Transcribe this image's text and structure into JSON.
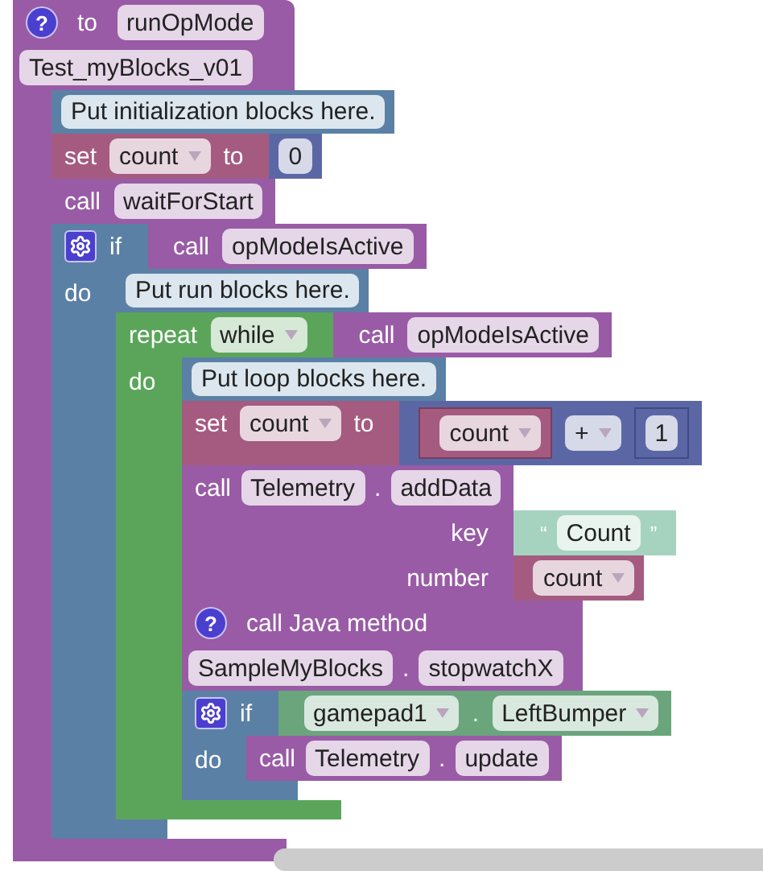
{
  "procedure": {
    "help": "?",
    "keyword": "to",
    "name": "runOpMode",
    "subtitle": "Test_myBlocks_v01",
    "statements": [
      {
        "kind": "comment",
        "text": "Put initialization blocks here."
      },
      {
        "kind": "set",
        "keyword": "set",
        "variable": "count",
        "to": "to",
        "value": {
          "kind": "number",
          "value": "0"
        }
      },
      {
        "kind": "call",
        "keyword": "call",
        "name": "waitForStart"
      },
      {
        "kind": "if",
        "keyword": "if",
        "do_label": "do",
        "condition": {
          "kind": "call",
          "keyword": "call",
          "name": "opModeIsActive"
        },
        "body": [
          {
            "kind": "comment",
            "text": "Put run blocks here."
          },
          {
            "kind": "repeat",
            "keyword": "repeat",
            "mode": "while",
            "do_label": "do",
            "condition": {
              "kind": "call",
              "keyword": "call",
              "name": "opModeIsActive"
            },
            "body": [
              {
                "kind": "comment",
                "text": "Put loop blocks here."
              },
              {
                "kind": "set",
                "keyword": "set",
                "variable": "count",
                "to": "to",
                "value": {
                  "kind": "arith",
                  "left": {
                    "kind": "variable",
                    "name": "count"
                  },
                  "op": "+",
                  "right": {
                    "kind": "number",
                    "value": "1"
                  }
                }
              },
              {
                "kind": "method_call",
                "keyword": "call",
                "object": "Telemetry",
                "separator": ".",
                "method": "addData",
                "args": [
                  {
                    "label": "key",
                    "value": {
                      "kind": "text",
                      "open": "“",
                      "value": "Count",
                      "close": "”"
                    }
                  },
                  {
                    "label": "number",
                    "value": {
                      "kind": "variable",
                      "name": "count"
                    }
                  }
                ]
              },
              {
                "kind": "java_call",
                "help": "?",
                "title": "call Java method",
                "class": "SampleMyBlocks",
                "separator": ".",
                "method": "stopwatchX"
              },
              {
                "kind": "if",
                "keyword": "if",
                "do_label": "do",
                "condition": {
                  "kind": "gamepad",
                  "object": "gamepad1",
                  "separator": ".",
                  "property": "LeftBumper"
                },
                "body": [
                  {
                    "kind": "method_call",
                    "keyword": "call",
                    "object": "Telemetry",
                    "separator": ".",
                    "method": "update"
                  }
                ]
              }
            ]
          }
        ]
      }
    ]
  }
}
